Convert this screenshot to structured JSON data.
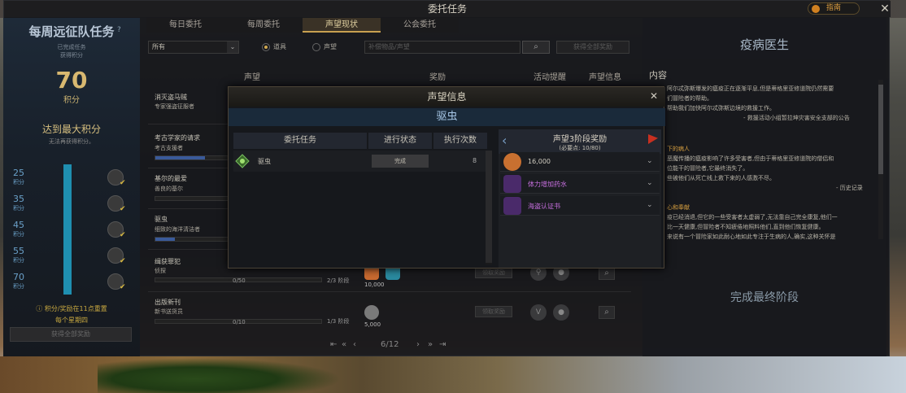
{
  "window": {
    "title": "委托任务",
    "guide_label": "指南",
    "close_label": "✕"
  },
  "left_panel": {
    "title": "每周远征队任务",
    "help": "?",
    "line1": "已完成任务",
    "line2": "获得积分",
    "score": "70",
    "score_label": "积分",
    "max_label": "达到最大积分",
    "max_sub": "无法再获得积分。",
    "tiers": [
      {
        "value": "25",
        "unit": "积分"
      },
      {
        "value": "35",
        "unit": "积分"
      },
      {
        "value": "45",
        "unit": "积分"
      },
      {
        "value": "55",
        "unit": "积分"
      },
      {
        "value": "70",
        "unit": "积分"
      }
    ],
    "reset_note": "积分/奖励在11点重置",
    "reset_day": "每个星期四",
    "claim_all": "获得全部奖励"
  },
  "tabs": [
    {
      "label": "每日委托"
    },
    {
      "label": "每周委托"
    },
    {
      "label": "声望现状"
    },
    {
      "label": "公会委托"
    }
  ],
  "filter": {
    "select_value": "所有",
    "radio1": "道具",
    "radio2": "声望",
    "search_placeholder": "补偿物品/声望",
    "claim_all": "获得全部奖励"
  },
  "table": {
    "headers": {
      "rep": "声望",
      "reward": "奖励",
      "alert": "活动提醒",
      "info": "声望信息"
    },
    "rows": [
      {
        "name": "消灭盗马贼",
        "sub": "专家强盗征服者",
        "progress": "",
        "stage": ""
      },
      {
        "name": "考古学家的请求",
        "sub": "考古支援者",
        "progress": "",
        "stage": ""
      },
      {
        "name": "基尔的最爱",
        "sub": "善良的基尔",
        "progress": "",
        "stage": ""
      },
      {
        "name": "驱虫",
        "sub": "细致的海洋清洁者",
        "progress": "",
        "stage": ""
      },
      {
        "name": "缉获罪犯",
        "sub": "侦探",
        "progress": "0/50",
        "stage": "2/3 阶段",
        "coin": "10,000",
        "collect": "领取奖励"
      },
      {
        "name": "出版新刊",
        "sub": "新书送货员",
        "progress": "0/10",
        "stage": "1/3 阶段",
        "coin": "5,000",
        "collect": "领取奖励"
      }
    ],
    "pagination": {
      "page": "6/12"
    }
  },
  "right_panel": {
    "title": "疫病医生",
    "content_label": "内容",
    "para1": [
      "阿尔忒弥斯爆发的瘟疫正在逐渐平息,但是蒂格里亚修道院仍然需要",
      "们冒险者的帮助。",
      "帮助我们加快阿尔忒弥斯边境的救援工作。"
    ],
    "sign1": "- 救援活动小组暂拉坤灾害安全支部的公告",
    "section2": "下的病人",
    "para2": [
      "恶魔传播的瘟疫影响了许多受害者,但由于蒂格里亚修道院的僧侣和",
      "位能干的冒险者,它最终消失了。",
      "些被他们从死亡线上救下来的人感激不尽。"
    ],
    "sign2": "- 历史记录",
    "section3": "心和奉献",
    "para3": [
      "疫已经消退,但它的一些受害者太虚弱了,无法靠自己完全康复,他们一",
      "比一天健康,但冒险者不知疲倦地照料他们,直到他们恢复健康。",
      "来说有一个冒险家如此耐心地如此专注于生病的人,确实,这种关怀是"
    ],
    "final_stage": "完成最终阶段"
  },
  "modal": {
    "title": "声望信息",
    "close": "✕",
    "subtitle": "驱虫",
    "headers": {
      "task": "委托任务",
      "status": "进行状态",
      "count": "执行次数"
    },
    "task": {
      "name": "驱虫",
      "status": "完成",
      "count": "8"
    },
    "reward_title": "声望3阶段奖励",
    "reward_sub": "(必要点: 10/80)",
    "rewards": [
      {
        "label": "16,000",
        "color": "#d0ccc0"
      },
      {
        "label": "体力增加药水",
        "color": "#c870e0"
      },
      {
        "label": "海盗认证书",
        "color": "#c870e0"
      }
    ]
  }
}
